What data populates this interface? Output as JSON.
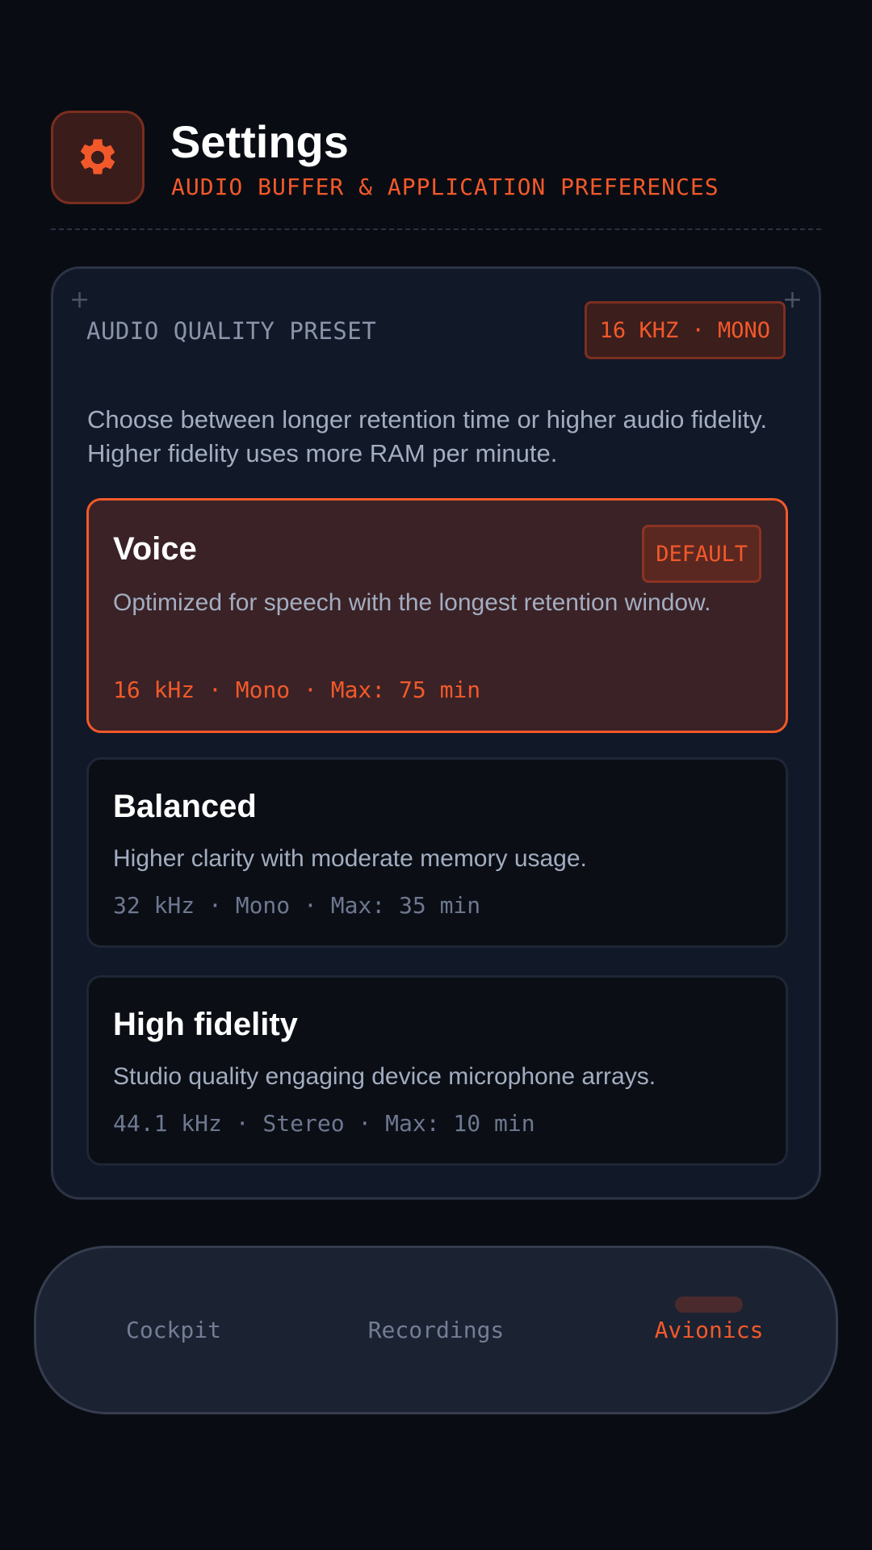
{
  "header": {
    "icon": "gear-icon",
    "title": "Settings",
    "subtitle": "AUDIO BUFFER & APPLICATION PREFERENCES"
  },
  "preset_panel": {
    "label": "AUDIO QUALITY PRESET",
    "badge": "16 KHZ · MONO",
    "description": "Choose between longer retention time or higher audio fidelity. Higher fidelity uses more RAM per minute.",
    "options": [
      {
        "title": "Voice",
        "description": "Optimized for speech with the longest retention window.",
        "specs": "16 kHz · Mono · Max: 75 min",
        "badge": "DEFAULT",
        "selected": true
      },
      {
        "title": "Balanced",
        "description": "Higher clarity with moderate memory usage.",
        "specs": "32 kHz · Mono · Max: 35 min",
        "selected": false
      },
      {
        "title": "High fidelity",
        "description": "Studio quality engaging device microphone arrays.",
        "specs": "44.1 kHz · Stereo · Max: 10 min",
        "selected": false
      }
    ]
  },
  "nav": {
    "items": [
      {
        "label": "Cockpit",
        "active": false
      },
      {
        "label": "Recordings",
        "active": false
      },
      {
        "label": "Avionics",
        "active": true
      }
    ]
  },
  "colors": {
    "background": "#090c13",
    "accent": "#f2592a",
    "panel": "#111827",
    "selected_card": "#3a2226"
  }
}
